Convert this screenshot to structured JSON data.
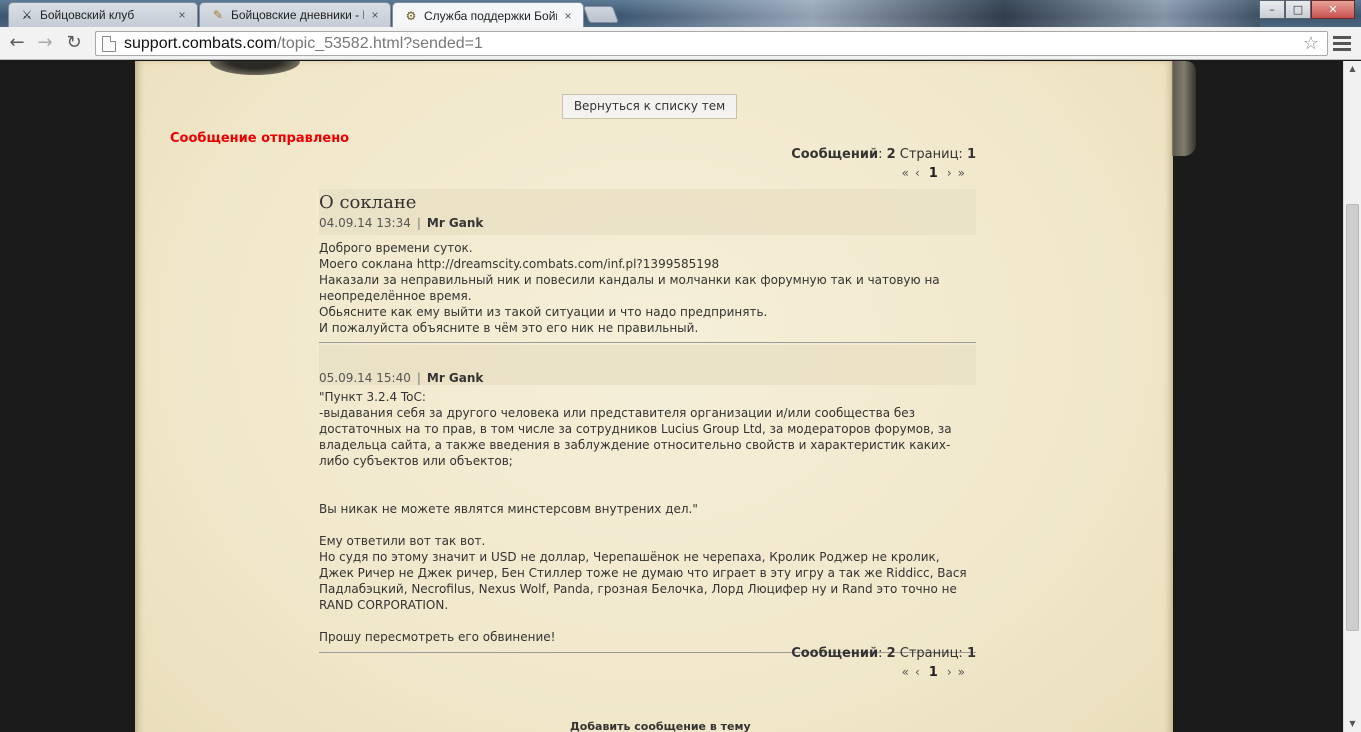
{
  "browser": {
    "tabs": [
      {
        "title": "Бойцовский клуб",
        "icon": "swords-icon"
      },
      {
        "title": "Бойцовские дневники - Н",
        "icon": "quill-icon"
      },
      {
        "title": "Служба поддержки Бойц",
        "icon": "gear-icon"
      }
    ],
    "tab_close": "×",
    "window": {
      "minimize": "–",
      "maximize": "□",
      "close": "✕"
    },
    "url_host": "support.combats.com",
    "url_path": "/topic_53582.html?sended=1",
    "nav": {
      "back": "←",
      "forward": "→",
      "reload": "↻",
      "star": "☆"
    }
  },
  "page": {
    "back_button": "Вернуться к списку тем",
    "sent_message": "Сообщение отправлено",
    "counter": {
      "messages_label": "Сообщений",
      "messages": "2",
      "pages_label": "Страниц:",
      "pages": "1"
    },
    "pager": {
      "first": "«",
      "prev": "‹",
      "current": "1",
      "next": "›",
      "last": "»"
    },
    "topic_title": "О соклане",
    "posts": [
      {
        "date": "04.09.14 13:34",
        "separator": "|",
        "author": "Mr Gank",
        "body": "Доброго времени суток.\nМоего соклана http://dreamscity.combats.com/inf.pl?1399585198\nНаказали за неправильный ник и повесили кандалы и молчанки как форумную так и чатовую на неопределённое время.\nОбьясните как ему выйти из такой ситуации и что надо предпринять.\nИ пожалуйста объясните в чём это его ник не правильный."
      },
      {
        "date": "05.09.14 15:40",
        "separator": "|",
        "author": "Mr Gank",
        "body": "\"Пункт 3.2.4 ToC:\n-выдавания себя за другого человека или представителя организации и/или сообщества без достаточных на то прав, в том числе за сотрудников Lucius Group Ltd, за модераторов форумов, за владельца сайта, а также введения в заблуждение относительно свойств и характеристик каких-либо субъектов или объектов;\n\n\nВы никак не можете являтся минстерсовм внутрених дел.\"\n\nЕму ответили вот так вот.\nНо судя по этому значит и USD не доллар, Черепашёнок не черепаха, Кролик Роджер не кролик, Джек Ричер не Джек ричер, Бен Стиллер тоже не думаю что играет в эту игру а так же Riddicc, Вася Падлабэцкий, Necrofilus, Nexus Wolf, Panda, грозная Белочка, Лорд Люцифер ну и Rand это точно не RAND CORPORATION.\n\nПрошу пересмотреть его обвинение!"
      }
    ],
    "add_message": "Добавить сообщение в тему"
  }
}
